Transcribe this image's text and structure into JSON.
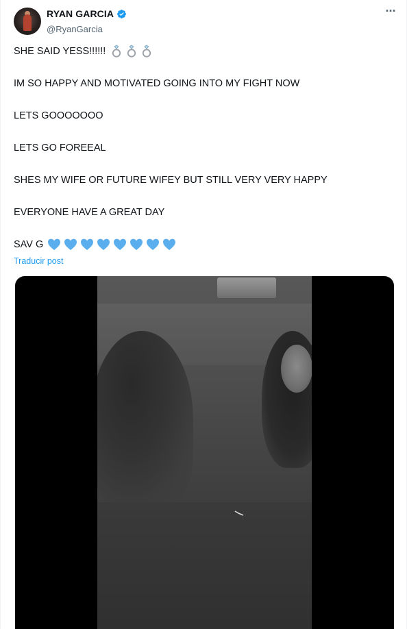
{
  "author": {
    "display_name": "RYAN GARCIA",
    "handle": "@RyanGarcia",
    "verified": true,
    "avatar_icon": "avatar-image"
  },
  "menu": {
    "icon": "more-options-icon",
    "label": "···"
  },
  "tweet": {
    "lines": [
      "SHE SAID YESS!!!!!!",
      "IM SO HAPPY AND MOTIVATED GOING INTO MY FIGHT NOW",
      "LETS GOOOOOOO",
      "LETS GO FOREEAL",
      "SHES MY WIFE OR FUTURE WIFEY BUT STILL VERY VERY HAPPY",
      "EVERYONE HAVE A GREAT DAY",
      "SAV G"
    ],
    "ring_emoji_count": 3,
    "heart_emoji_count": 8,
    "translate_label": "Traducir post"
  },
  "colors": {
    "accent": "#1d9bf0",
    "heart": "#5aaeed",
    "secondary_text": "#536471"
  },
  "media": {
    "type": "video"
  }
}
